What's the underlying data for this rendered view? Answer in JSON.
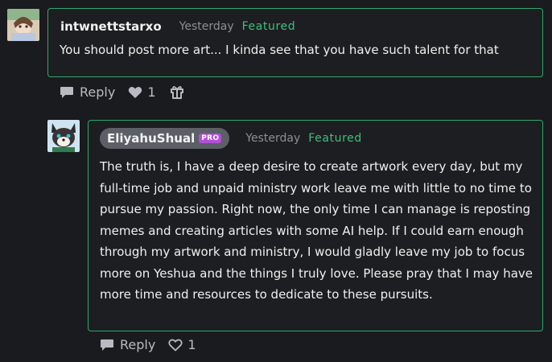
{
  "comment1": {
    "username": "intwnettstarxo",
    "time": "Yesterday",
    "badge": "Featured",
    "text": "You should post more art... I kinda see that you have such talent for that",
    "reply_label": "Reply",
    "like_count": "1"
  },
  "comment2": {
    "username": "EliyahuShual",
    "pro_badge": "PRO",
    "time": "Yesterday",
    "badge": "Featured",
    "text": "The truth is, I have a deep desire to create artwork every day, but my full-time job and unpaid ministry work leave me with little to no time to pursue my passion. Right now, the only time I can manage is reposting memes and creating articles with some AI help. If I could earn enough through my artwork and ministry, I would gladly leave my job to focus more on Yeshua and the things I truly love. Please pray that I may have more time and resources to dedicate to these pursuits.",
    "reply_label": "Reply",
    "like_count": "1"
  },
  "colors": {
    "background": "#1a1b1e",
    "card_border": "#2ea86a",
    "featured": "#3fbf7f",
    "pro": "#b14fd6"
  },
  "icons": [
    "avatar-anime-girl",
    "avatar-fox",
    "comment-icon",
    "heart-icon",
    "gift-icon"
  ]
}
